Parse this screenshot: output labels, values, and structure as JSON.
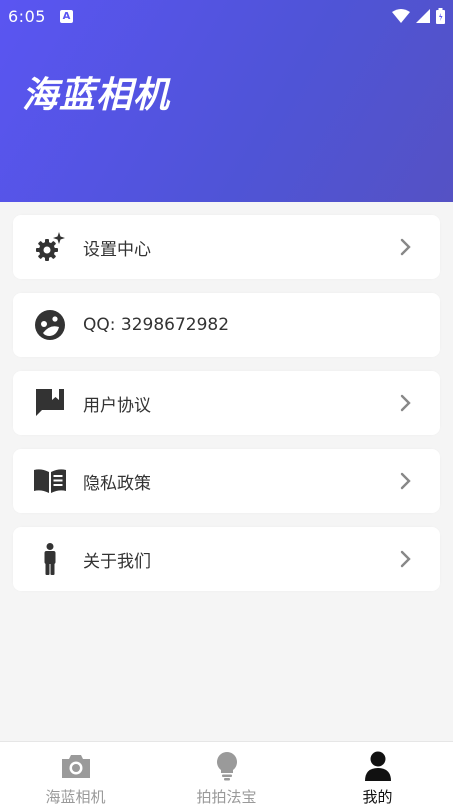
{
  "status_bar": {
    "time": "6:05",
    "app_icon": "A"
  },
  "header": {
    "title": "海蓝相机"
  },
  "menu": [
    {
      "label": "设置中心",
      "icon": "gear-sparkle-icon",
      "has_chevron": true
    },
    {
      "label": "QQ: 3298672982",
      "icon": "face-icon",
      "has_chevron": false
    },
    {
      "label": "用户协议",
      "icon": "bookmark-chat-icon",
      "has_chevron": true
    },
    {
      "label": "隐私政策",
      "icon": "book-icon",
      "has_chevron": true
    },
    {
      "label": "关于我们",
      "icon": "person-icon",
      "has_chevron": true
    }
  ],
  "bottom_nav": [
    {
      "label": "海蓝相机",
      "icon": "camera-icon",
      "active": false
    },
    {
      "label": "拍拍法宝",
      "icon": "lightbulb-icon",
      "active": false
    },
    {
      "label": "我的",
      "icon": "user-icon",
      "active": true
    }
  ],
  "colors": {
    "header_gradient_start": "#5a55f2",
    "header_gradient_end": "#5552c4",
    "icon": "#333333",
    "chevron": "#888888"
  }
}
